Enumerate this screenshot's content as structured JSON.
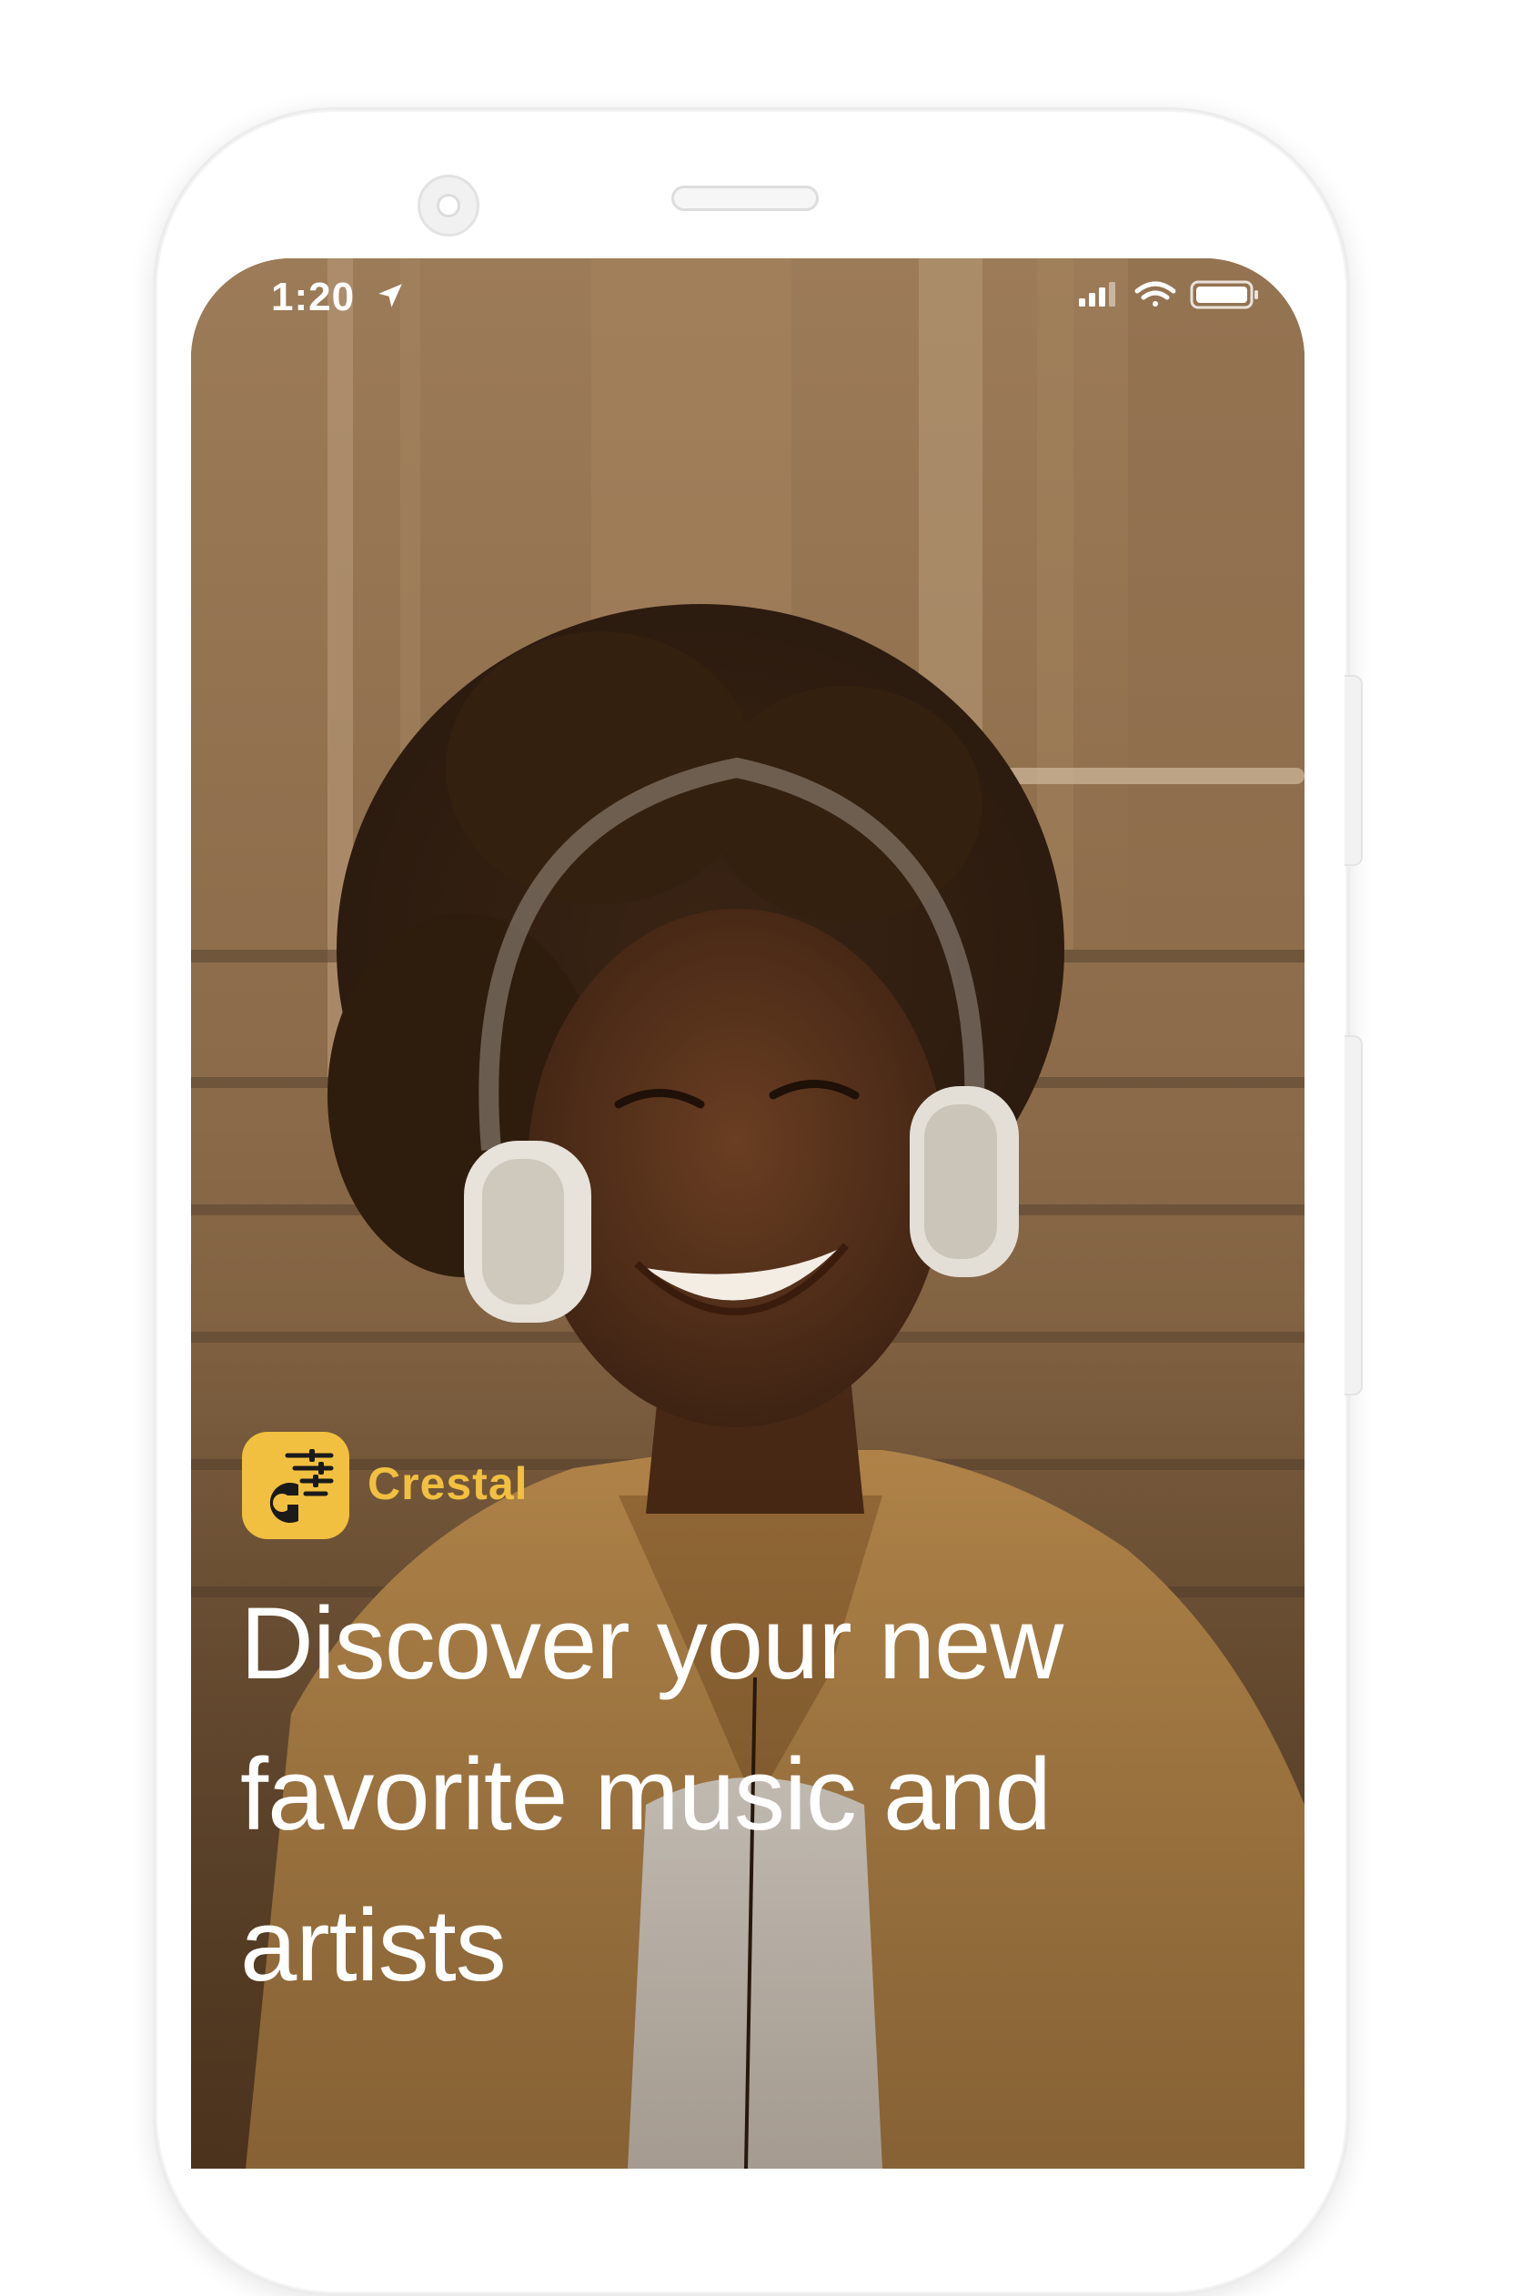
{
  "status_bar": {
    "time": "1:20",
    "location_icon": "location-arrow-icon",
    "signal_icon": "cellular-signal-icon",
    "wifi_icon": "wifi-icon",
    "battery_icon": "battery-icon"
  },
  "brand": {
    "name": "Crestal",
    "logo_icon": "crestal-logo-icon",
    "color": "#f2c040"
  },
  "hero": {
    "headline": "Discover your new favorite music and artists"
  },
  "colors": {
    "headline": "#ffffff",
    "brand_accent": "#f2c040",
    "photo_tone": "#6a4a2c"
  }
}
